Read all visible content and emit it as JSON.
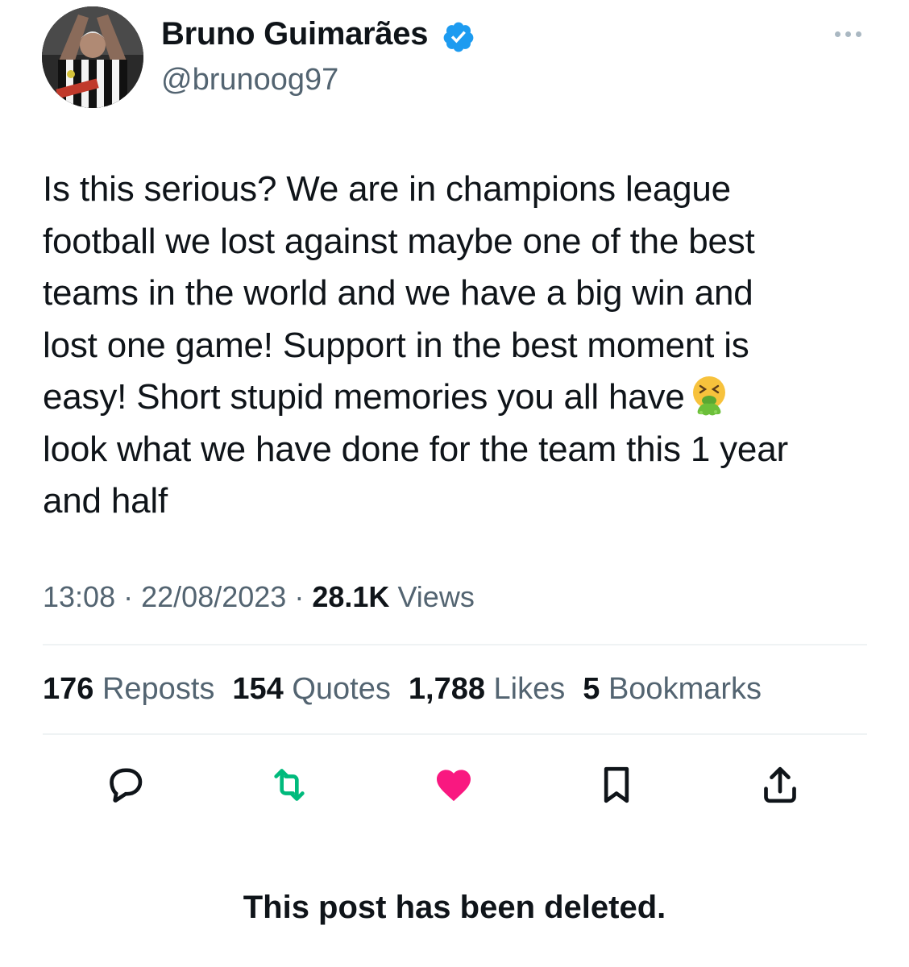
{
  "author": {
    "name": "Bruno Guimarães",
    "handle": "@brunoog97",
    "verified": true,
    "avatar": "avatar"
  },
  "menu": {
    "icon": "more-dots-icon"
  },
  "tweet": {
    "lines": [
      "Is this serious? We are in champions league",
      "football we lost against maybe one of the best",
      "teams in the world and we have a big win and",
      "lost one game! Support in the best moment is",
      "easy! Short stupid memories you all have",
      "look what we have done for the team this 1 year",
      "and half"
    ],
    "emoji": "vomiting-face-emoji"
  },
  "meta": {
    "time": "13:08",
    "date": "22/08/2023",
    "views_count": "28.1K",
    "views_label": "Views",
    "separator": "·"
  },
  "stats": [
    {
      "count": "176",
      "label": "Reposts"
    },
    {
      "count": "154",
      "label": "Quotes"
    },
    {
      "count": "1,788",
      "label": "Likes"
    },
    {
      "count": "5",
      "label": "Bookmarks"
    }
  ],
  "actions": [
    {
      "icon": "reply-icon"
    },
    {
      "icon": "repost-icon"
    },
    {
      "icon": "heart-icon"
    },
    {
      "icon": "bookmark-icon"
    },
    {
      "icon": "share-icon"
    }
  ],
  "notice": "This post has been deleted.",
  "colors": {
    "text": "#0f1419",
    "secondary": "#536471",
    "verified": "#1d9bf0",
    "repost": "#00ba7c",
    "like": "#f91880",
    "divider": "#eff3f4"
  }
}
